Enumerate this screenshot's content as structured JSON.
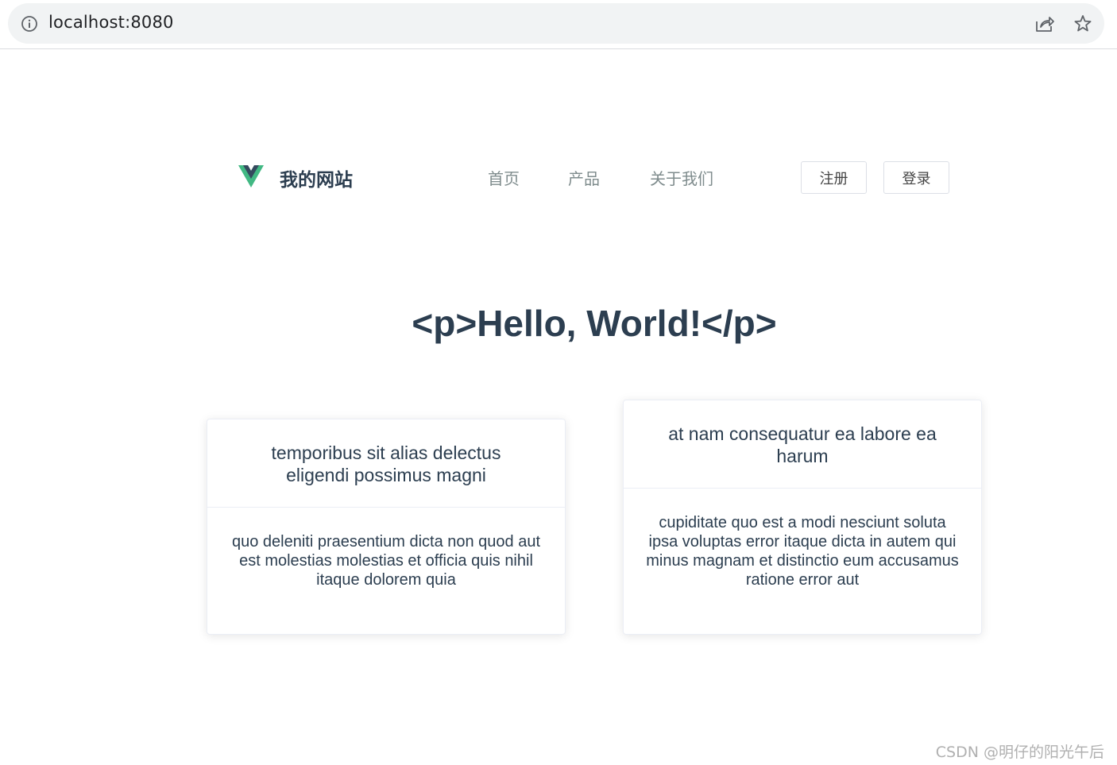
{
  "browser": {
    "url": "localhost:8080"
  },
  "site": {
    "title": "我的网站",
    "nav": [
      "首页",
      "产品",
      "关于我们"
    ],
    "register_label": "注册",
    "login_label": "登录",
    "logo_colors": {
      "outer": "#41b883",
      "inner": "#34495e"
    }
  },
  "main": {
    "heading": "<p>Hello, World!</p>",
    "cards": [
      {
        "title": "temporibus sit alias delectus eligendi possimus magni",
        "body": "quo deleniti praesentium dicta non quod aut est molestias molestias et officia quis nihil itaque dolorem quia"
      },
      {
        "title": "at nam consequatur ea labore ea harum",
        "body": "cupiditate quo est a modi nesciunt soluta ipsa voluptas error itaque dicta in autem qui minus magnam et distinctio eum accusamus ratione error aut"
      }
    ]
  },
  "watermark": "CSDN @明仔的阳光午后"
}
